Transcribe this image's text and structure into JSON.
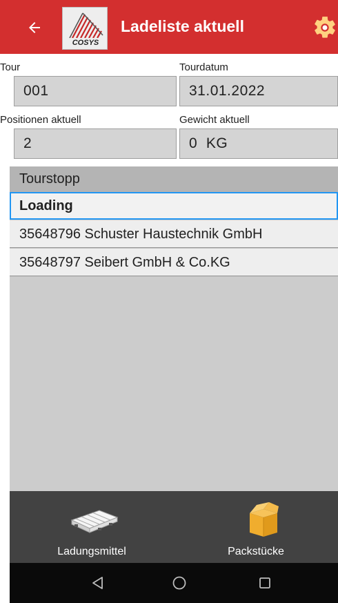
{
  "app_bar": {
    "title": "Ladeliste aktuell",
    "logo_text": "COSYS",
    "background_color": "#d32f2f",
    "back_icon": "arrow-left-icon",
    "settings_icon": "gear-icon"
  },
  "form": {
    "tour": {
      "label": "Tour",
      "value": "001"
    },
    "tourdatum": {
      "label": "Tourdatum",
      "value": "31.01.2022"
    },
    "positionen": {
      "label": "Positionen aktuell",
      "value": "2"
    },
    "gewicht": {
      "label": "Gewicht aktuell",
      "value": "0  KG"
    }
  },
  "list": {
    "header": "Tourstopp",
    "items": [
      {
        "label": "Loading",
        "selected": true
      },
      {
        "label": "35648796 Schuster Haustechnik GmbH",
        "selected": false
      },
      {
        "label": "35648797 Seibert GmbH & Co.KG",
        "selected": false
      }
    ],
    "selection_color": "#2196f3"
  },
  "toolbar": {
    "items": [
      {
        "label": "Ladungsmittel",
        "icon": "pallet-icon"
      },
      {
        "label": "Packstücke",
        "icon": "package-box-icon"
      }
    ]
  },
  "system_nav": {
    "back_icon": "nav-back-triangle-icon",
    "home_icon": "nav-home-circle-icon",
    "recents_icon": "nav-recents-square-icon"
  }
}
